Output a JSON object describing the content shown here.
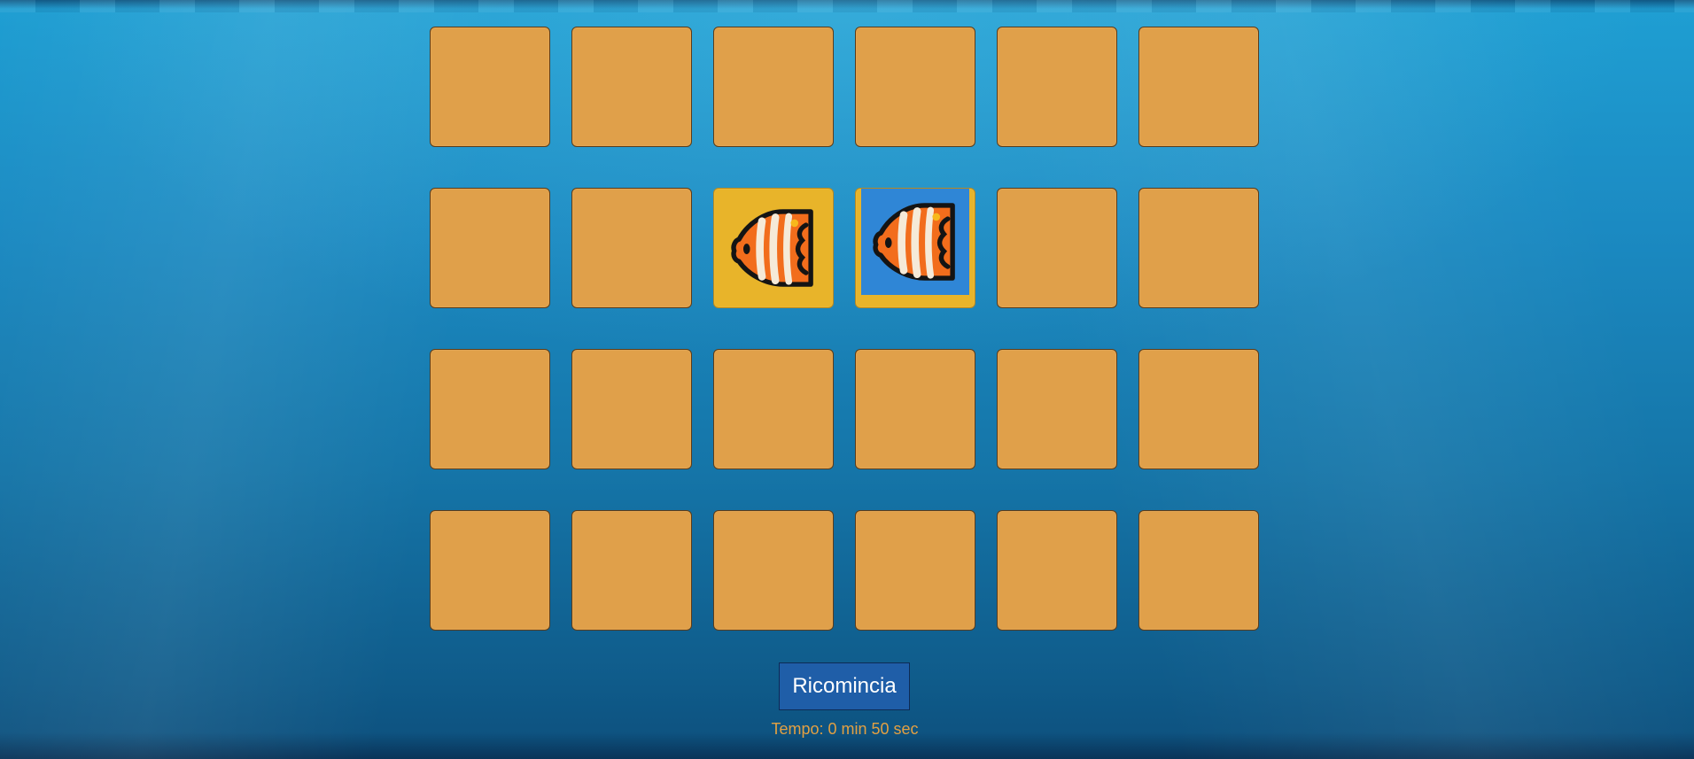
{
  "game": {
    "rows": 4,
    "cols": 6,
    "card_back_color": "#e0a04a",
    "revealed_cards": [
      {
        "row": 1,
        "col": 2,
        "icon": "butterflyfish-icon",
        "background": "#e8b42a"
      },
      {
        "row": 1,
        "col": 3,
        "icon": "butterflyfish-icon",
        "background": "#2f86d6"
      }
    ]
  },
  "controls": {
    "restart_label": "Ricomincia"
  },
  "timer": {
    "text": "Tempo: 0 min 50 sec"
  },
  "colors": {
    "water_top": "#1f9fd3",
    "water_bottom": "#0d4f7c",
    "button_bg": "#1f5ea8",
    "timer_text": "#e3a042"
  }
}
